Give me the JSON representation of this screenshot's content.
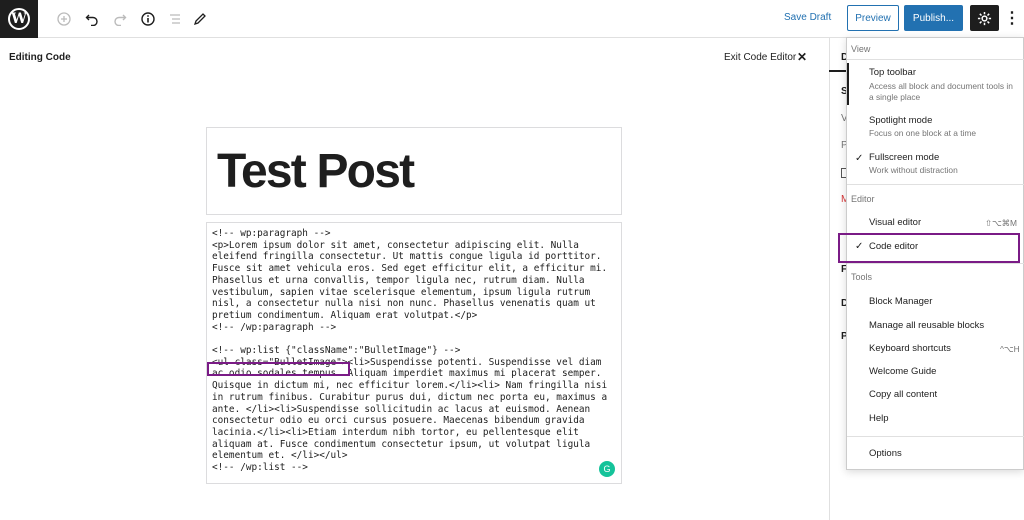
{
  "toolbar": {
    "logo_letter": "W",
    "icons": [
      "wordpress-logo-icon",
      "add-block-icon",
      "undo-icon",
      "redo-icon",
      "info-icon",
      "list-view-icon",
      "edit-tools-icon",
      "settings-gear-icon",
      "more-options-icon"
    ],
    "save_draft": "Save Draft",
    "preview": "Preview",
    "publish": "Publish..."
  },
  "editor": {
    "mode_label": "Editing Code",
    "exit_label": "Exit Code Editor",
    "title": "Test Post",
    "code": "<!-- wp:paragraph -->\n<p>Lorem ipsum dolor sit amet, consectetur adipiscing elit. Nulla eleifend fringilla consectetur. Ut mattis congue ligula id porttitor. Fusce sit amet vehicula eros. Sed eget efficitur elit, a efficitur mi. Phasellus et urna convallis, tempor ligula nec, rutrum diam. Nulla vestibulum, sapien vitae scelerisque elementum, ipsum ligula rutrum nisl, a consectetur nulla nisi non nunc. Phasellus venenatis quam ut pretium condimentum. Aliquam erat volutpat.</p>\n<!-- /wp:paragraph -->\n\n<!-- wp:list {\"className\":\"BulletImage\"} -->\n<ul class=\"BulletImage\"><li>Suspendisse potenti. Suspendisse vel diam ac odio sodales tempus. Aliquam imperdiet maximus mi placerat semper. Quisque in dictum mi, nec efficitur lorem.</li><li> Nam fringilla nisi in rutrum finibus. Curabitur purus dui, dictum nec porta eu, maximus a ante. </li><li>Suspendisse sollicitudin ac lacus at euismod. Aenean consectetur odio eu orci cursus posuere. Maecenas bibendum gravida lacinia.</li><li>Etiam interdum nibh tortor, eu pellentesque elit aliquam at. Fusce condimentum consectetur ipsum, ut volutpat ligula elementum et. </li></ul>\n<!-- /wp:list -->"
  },
  "sidebar": {
    "tab_letter": "D",
    "letters": [
      "S",
      "V",
      "P",
      "M",
      "F",
      "D",
      "P"
    ]
  },
  "menu": {
    "view_label": "View",
    "top_toolbar": {
      "title": "Top toolbar",
      "desc": "Access all block and document tools in a single place"
    },
    "spotlight": {
      "title": "Spotlight mode",
      "desc": "Focus on one block at a time"
    },
    "fullscreen": {
      "title": "Fullscreen mode",
      "desc": "Work without distraction",
      "check": "✓"
    },
    "editor_label": "Editor",
    "visual_editor": {
      "title": "Visual editor",
      "shortcut": "⇧⌥⌘M"
    },
    "code_editor": {
      "title": "Code editor",
      "check": "✓"
    },
    "tools_label": "Tools",
    "tools": [
      {
        "title": "Block Manager"
      },
      {
        "title": "Manage all reusable blocks"
      },
      {
        "title": "Keyboard shortcuts",
        "shortcut": "^⌥H"
      },
      {
        "title": "Welcome Guide"
      },
      {
        "title": "Copy all content"
      },
      {
        "title": "Help"
      }
    ],
    "options": "Options"
  }
}
